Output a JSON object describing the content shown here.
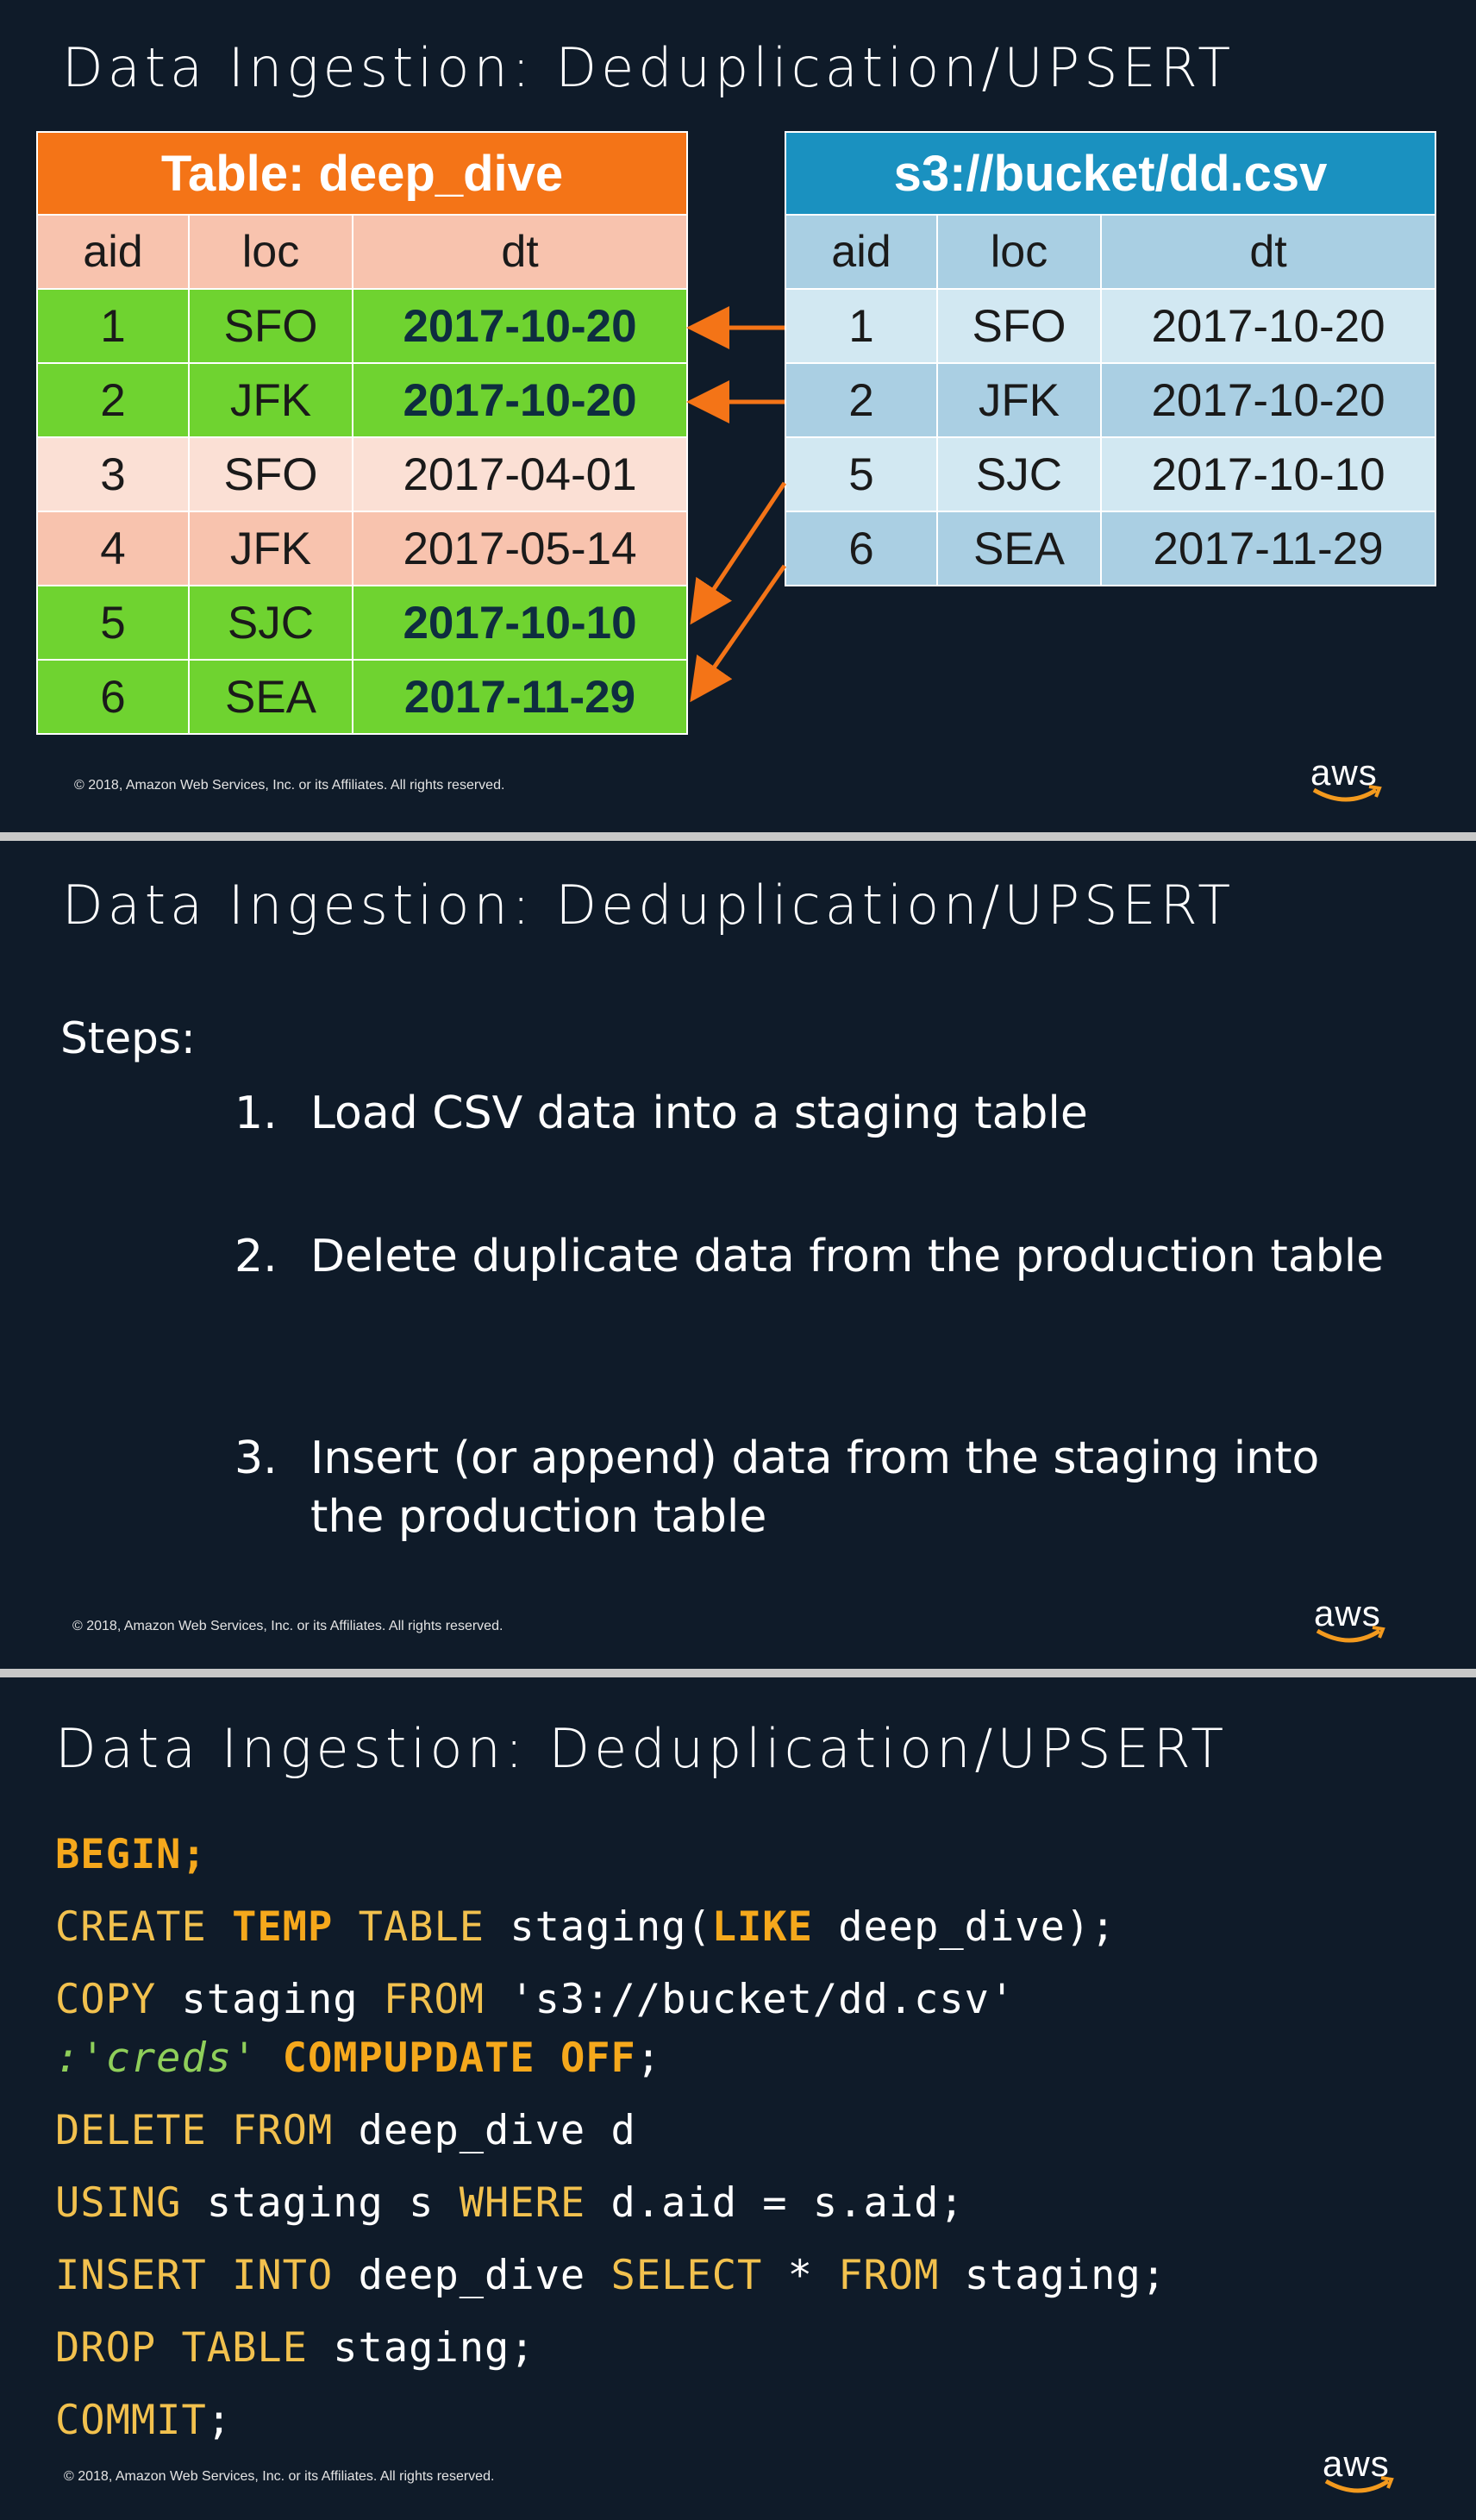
{
  "slides": [
    {
      "title": "Data Ingestion: Deduplication/UPSERT",
      "target_table": {
        "caption": "Table: deep_dive",
        "headers": [
          "aid",
          "loc",
          "dt"
        ],
        "rows": [
          [
            "1",
            "SFO",
            "2017-10-20"
          ],
          [
            "2",
            "JFK",
            "2017-10-20"
          ],
          [
            "3",
            "SFO",
            "2017-04-01"
          ],
          [
            "4",
            "JFK",
            "2017-05-14"
          ],
          [
            "5",
            "SJC",
            "2017-10-10"
          ],
          [
            "6",
            "SEA",
            "2017-11-29"
          ]
        ]
      },
      "source_table": {
        "caption": "s3://bucket/dd.csv",
        "headers": [
          "aid",
          "loc",
          "dt"
        ],
        "rows": [
          [
            "1",
            "SFO",
            "2017-10-20"
          ],
          [
            "2",
            "JFK",
            "2017-10-20"
          ],
          [
            "5",
            "SJC",
            "2017-10-10"
          ],
          [
            "6",
            "SEA",
            "2017-11-29"
          ]
        ]
      },
      "colors": {
        "caption_orange": "#f47417",
        "caption_blue": "#1a91c0",
        "upserted_green": "#6fd330",
        "arrow_orange": "#f47417"
      },
      "footer": "© 2018, Amazon Web Services, Inc. or its Affiliates. All rights reserved.",
      "logo": "aws"
    },
    {
      "title": "Data Ingestion: Deduplication/UPSERT",
      "steps_label": "Steps:",
      "steps": [
        {
          "num": "1.",
          "text": "Load CSV data into a staging table"
        },
        {
          "num": "2.",
          "text": "Delete duplicate data from the production table"
        },
        {
          "num": "3.",
          "text": "Insert (or append) data from the staging into the production table"
        }
      ],
      "footer": "© 2018, Amazon Web Services, Inc. or its Affiliates. All rights reserved.",
      "logo": "aws"
    },
    {
      "title": "Data Ingestion: Deduplication/UPSERT",
      "code": {
        "begin": "BEGIN",
        "create_kw": "CREATE",
        "temp_kw": "TEMP",
        "table_kw": "TABLE",
        "staging_open": "staging(",
        "like_kw": "LIKE",
        "deep_dive_close": "deep_dive);",
        "copy_kw": "COPY",
        "staging": "staging",
        "from_kw": "FROM",
        "s3_path": "'s3://bucket/dd.csv'",
        "creds": ":'creds'",
        "compupdate_kw": "COMPUPDATE",
        "off_kw": "OFF",
        "delete_kw": "DELETE",
        "deep_dive_d": "deep_dive d",
        "using_kw": "USING",
        "staging_s": "staging s",
        "where_kw": "WHERE",
        "condition": "d.aid = s.aid;",
        "insert_kw": "INSERT",
        "into_kw": "INTO",
        "deep_dive": "deep_dive",
        "select_kw": "SELECT",
        "star": "*",
        "staging_semi": "staging;",
        "drop_kw": "DROP",
        "commit_kw": "COMMIT",
        "semi": ";"
      },
      "footer": "© 2018, Amazon Web Services, Inc. or its Affiliates. All rights reserved.",
      "logo": "aws"
    }
  ]
}
